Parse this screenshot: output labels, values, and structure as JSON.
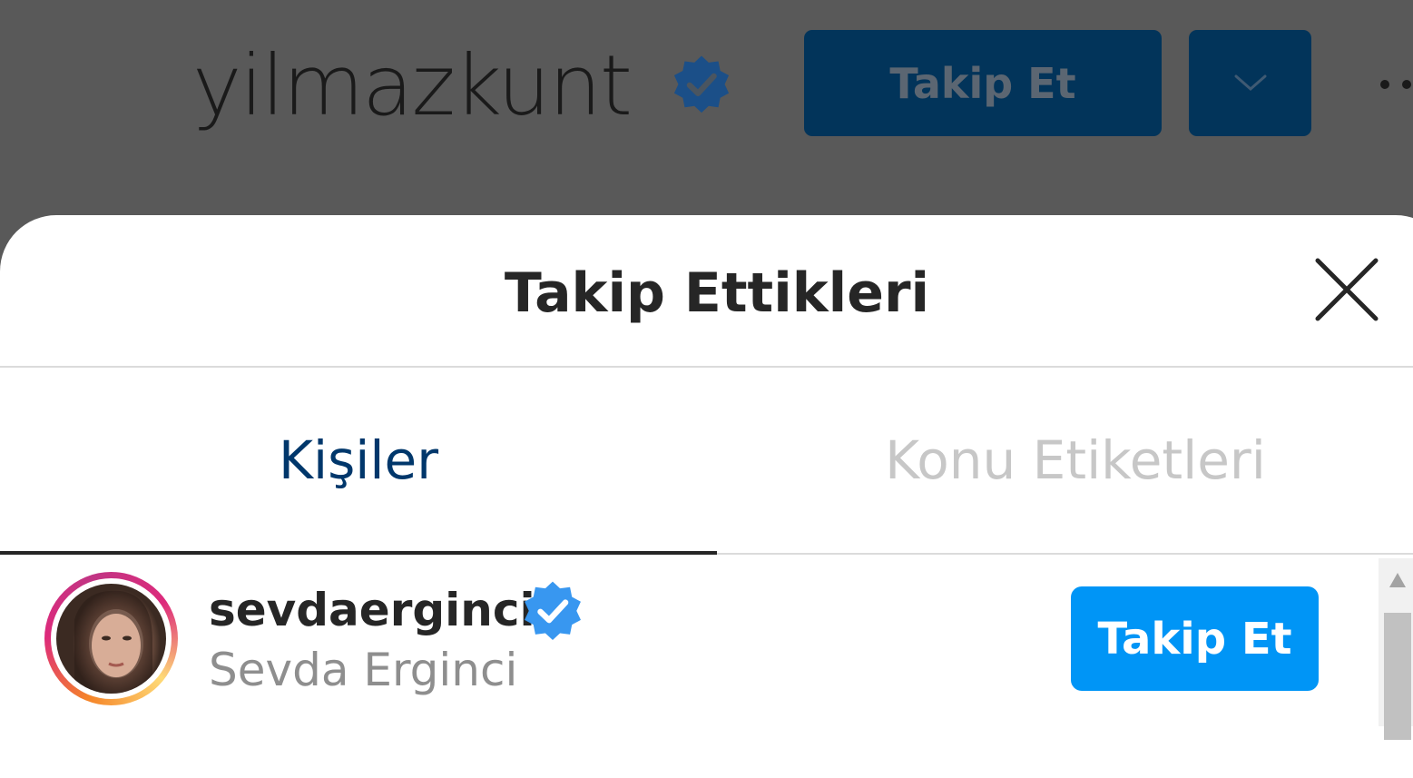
{
  "profile": {
    "username": "yilmazkunt",
    "follow_label": "Takip Et"
  },
  "modal": {
    "title": "Takip Ettikleri",
    "tabs": [
      {
        "label": "Kişiler",
        "active": true
      },
      {
        "label": "Konu Etiketleri",
        "active": false
      }
    ]
  },
  "list": [
    {
      "username": "sevdaerginci",
      "full_name": "Sevda Erginci",
      "verified": true,
      "follow_label": "Takip Et"
    }
  ],
  "colors": {
    "primary_button": "#0095f6",
    "verified_badge": "#3897f0",
    "active_tab_text": "#00376b",
    "inactive_tab_text": "#c7c7c7",
    "overlay": "#595959"
  },
  "icons": {
    "verified": "verified-badge-icon",
    "close": "close-icon",
    "dropdown": "chevron-down-icon",
    "more": "more-options-icon",
    "scroll_up": "scroll-up-arrow-icon"
  }
}
